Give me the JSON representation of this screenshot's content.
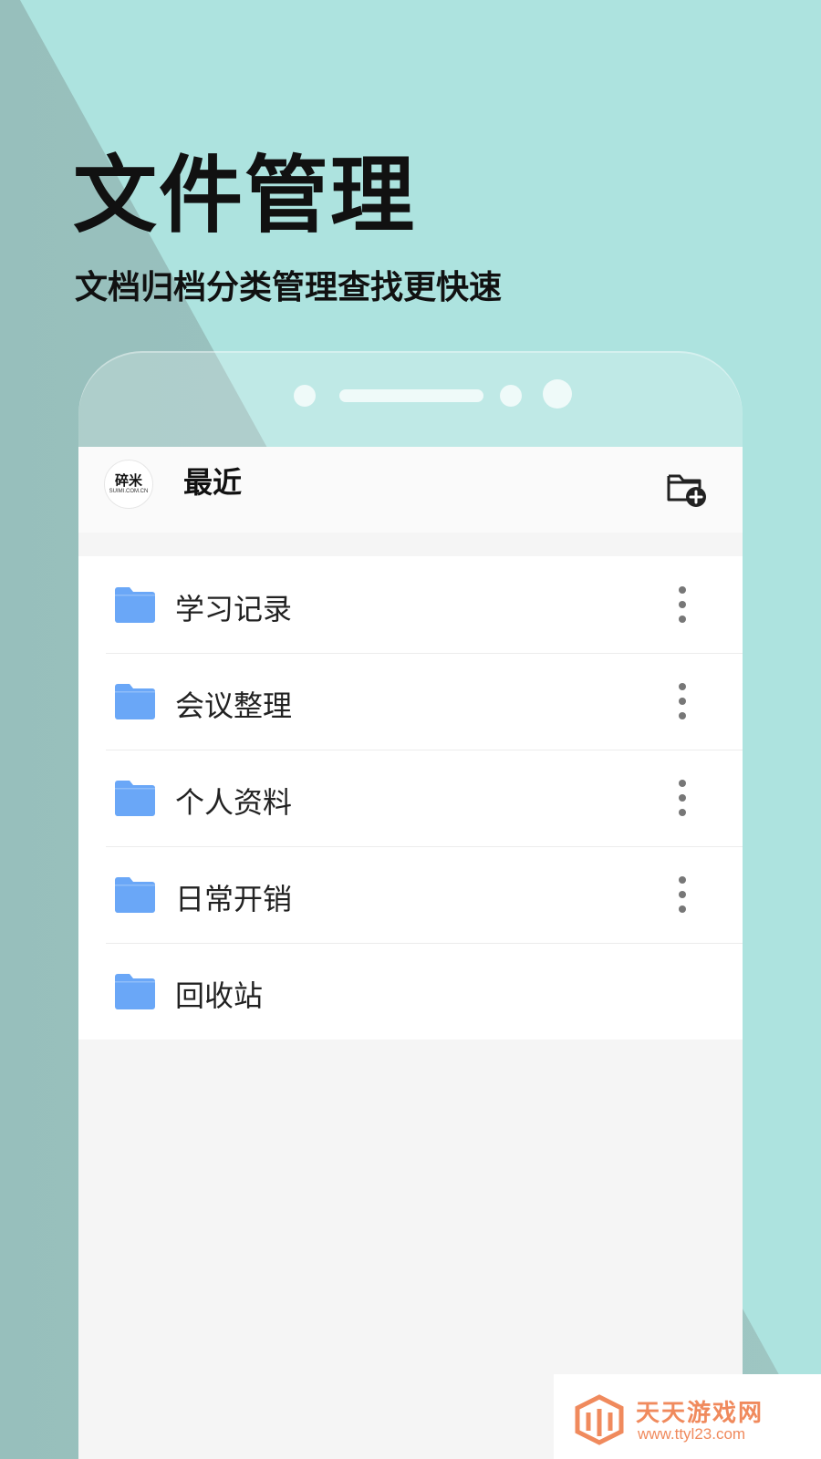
{
  "hero": {
    "title": "文件管理",
    "subtitle": "文档归档分类管理查找更快速"
  },
  "app": {
    "logo_text": "碎米",
    "logo_subtext": "SUIMI.COM.CN",
    "header_title": "最近",
    "new_folder_icon": "folder-plus-icon"
  },
  "folders": [
    {
      "label": "学习记录",
      "has_menu": true
    },
    {
      "label": "会议整理",
      "has_menu": true
    },
    {
      "label": "个人资料",
      "has_menu": true
    },
    {
      "label": "日常开销",
      "has_menu": true
    },
    {
      "label": "回收站",
      "has_menu": false
    }
  ],
  "watermark": {
    "name": "天天游戏网",
    "url": "www.ttyl23.com"
  },
  "colors": {
    "background": "#ade3df",
    "diagonal": "#9ec6c3",
    "folder": "#6aa7f7",
    "watermark": "#f08a5d"
  }
}
